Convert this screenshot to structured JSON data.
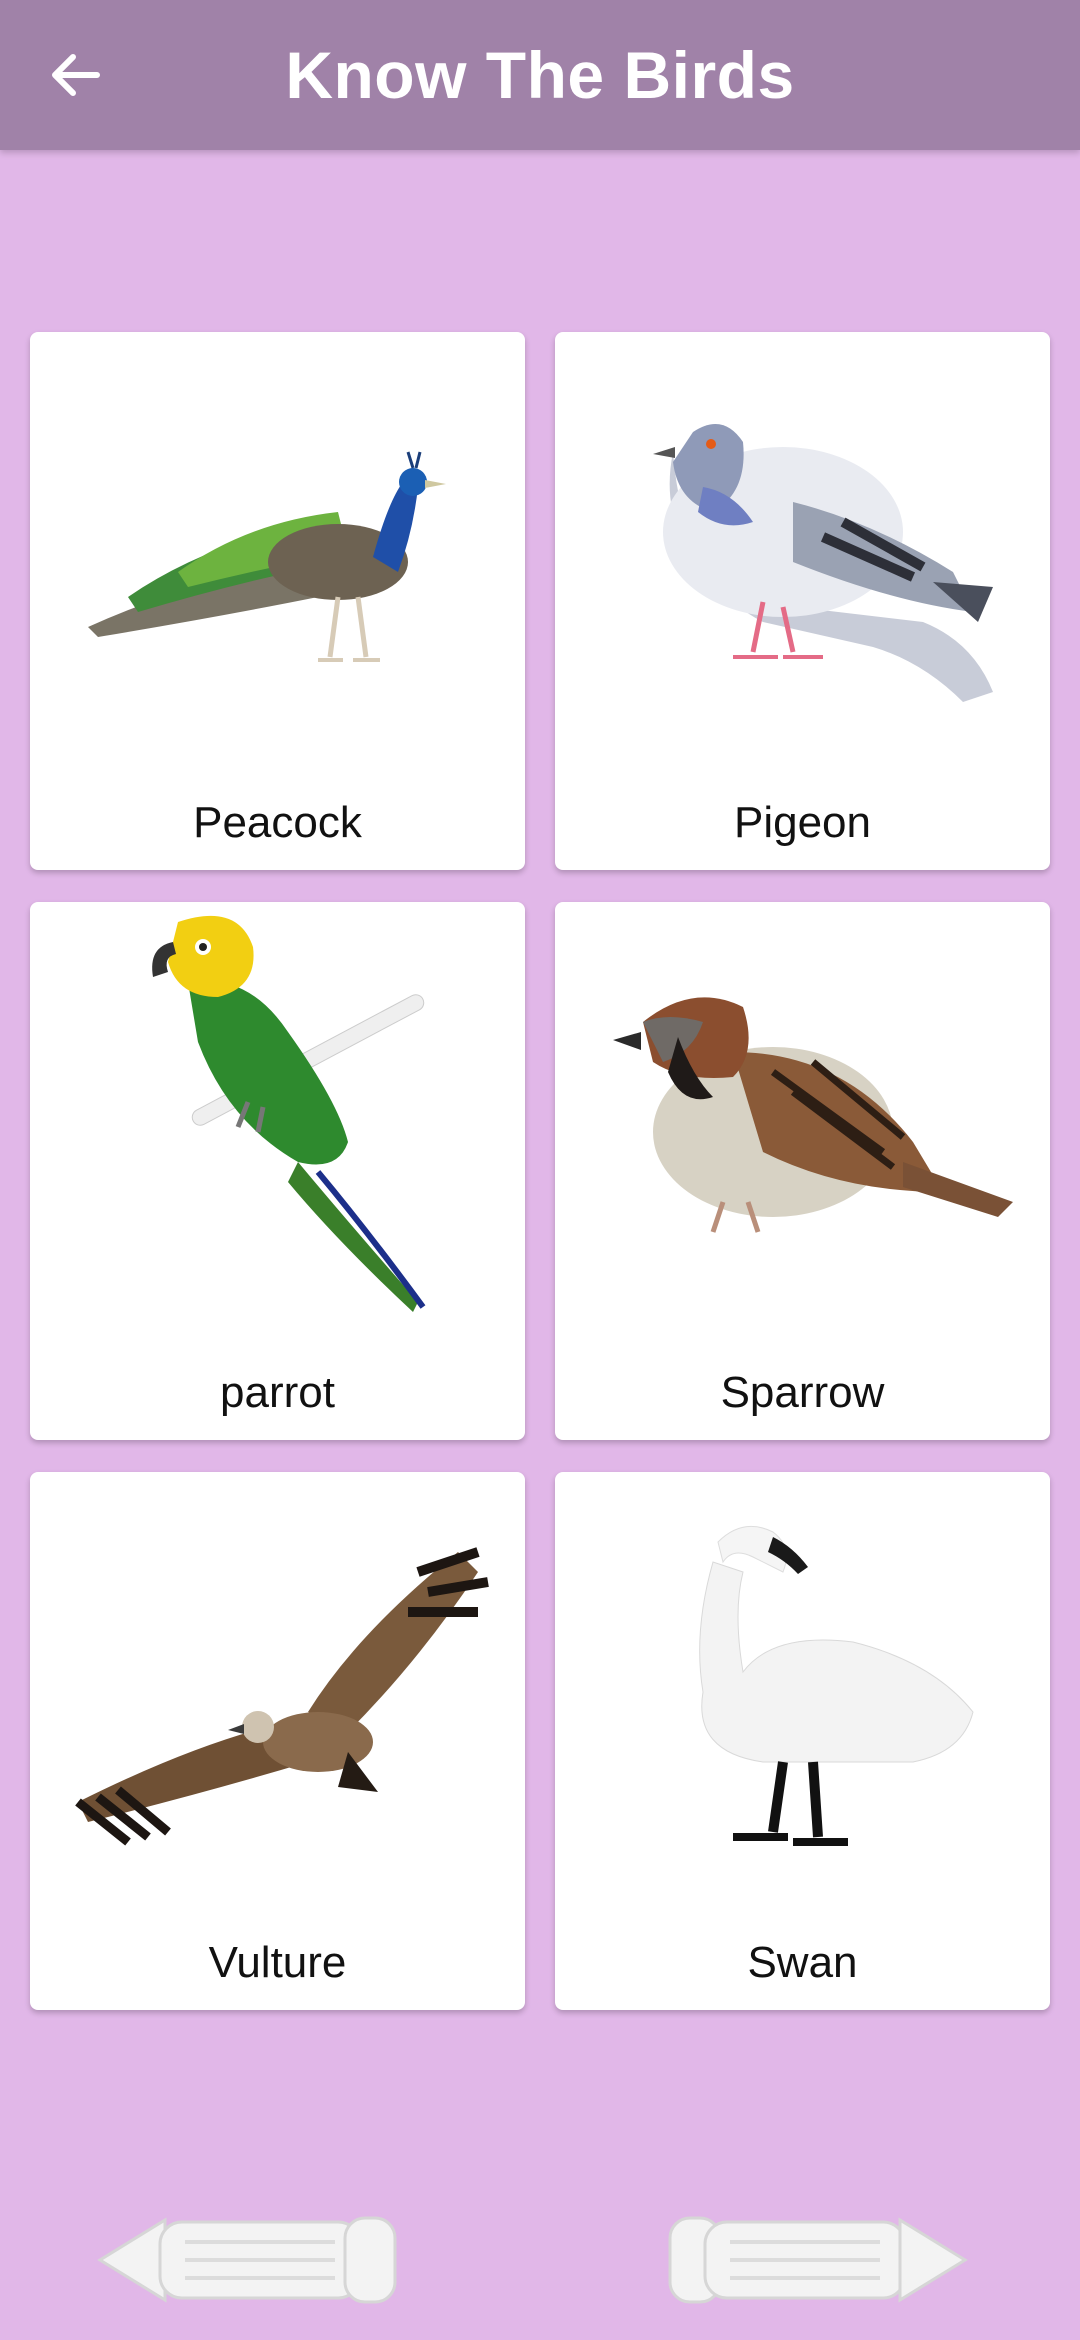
{
  "appbar": {
    "title": "Know The Birds",
    "back_icon": "arrow-left-icon",
    "color": "#a082a8"
  },
  "background": "#e1b7e8",
  "birds": [
    {
      "label": "Peacock",
      "icon": "peacock-image"
    },
    {
      "label": "Pigeon",
      "icon": "pigeon-image"
    },
    {
      "label": "parrot",
      "icon": "parrot-image"
    },
    {
      "label": "Sparrow",
      "icon": "sparrow-image"
    },
    {
      "label": "Vulture",
      "icon": "vulture-image"
    },
    {
      "label": "Swan",
      "icon": "swan-image"
    }
  ],
  "navigation": {
    "prev_icon": "previous-arrow-icon",
    "next_icon": "next-arrow-icon"
  }
}
